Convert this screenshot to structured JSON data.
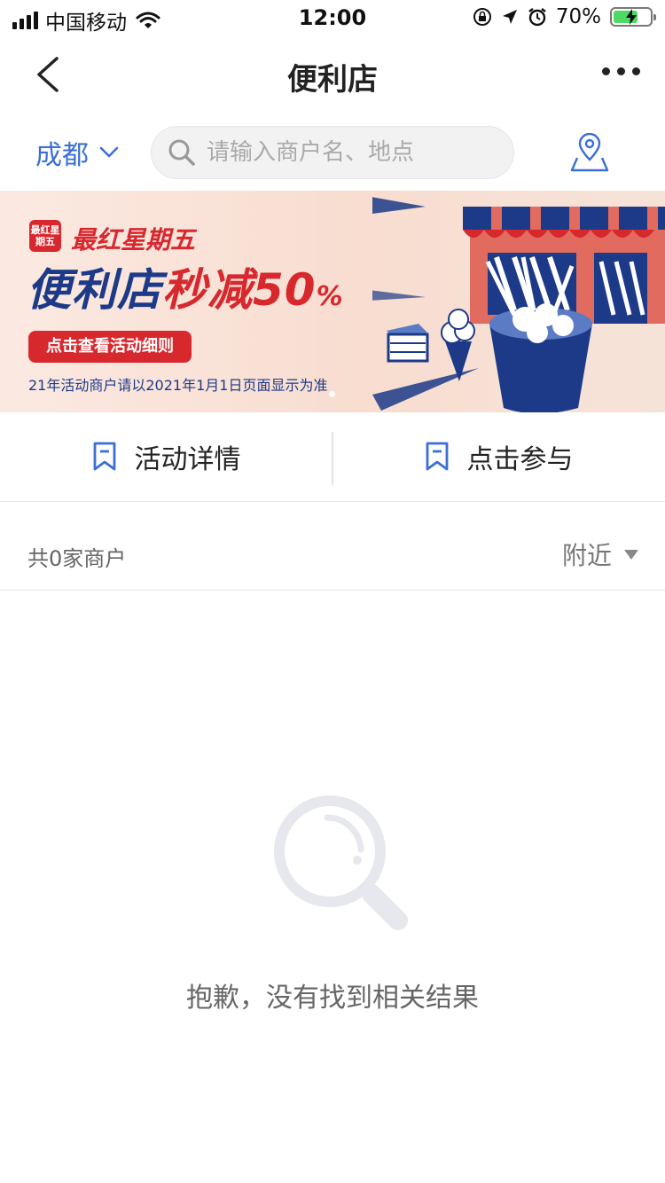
{
  "status_bar": {
    "carrier": "中国移动",
    "time": "12:00",
    "battery_percent": "70%",
    "icons": [
      "signal-icon",
      "wifi-icon",
      "rotation-lock-icon",
      "location-arrow-icon",
      "alarm-icon",
      "battery-charging-icon"
    ]
  },
  "nav": {
    "title": "便利店",
    "back_icon": "chevron-left-icon",
    "more_icon": "more-dots-icon"
  },
  "search_row": {
    "city": "成都",
    "search_placeholder": "请输入商户名、地点",
    "location_icon": "map-pin-icon"
  },
  "banner": {
    "logo_text": "最红星期五",
    "headline_small": "最红星期五",
    "headline_main_blue": "便利店",
    "headline_main_red": "秒减",
    "headline_number": "50",
    "headline_percent": "%",
    "rules_button": "点击查看活动细则",
    "note": "21年活动商户请以2021年1月1日页面显示为准",
    "colors": {
      "red": "#d7282e",
      "navy": "#1c3a88"
    }
  },
  "actions": [
    {
      "label": "活动详情",
      "icon": "bookmark-icon"
    },
    {
      "label": "点击参与",
      "icon": "bookmark-icon"
    }
  ],
  "list": {
    "count_text": "共0家商户",
    "sort_label": "附近"
  },
  "empty": {
    "message": "抱歉，没有找到相关结果",
    "icon": "magnifier-icon"
  },
  "colors": {
    "accent": "#3b6fd6",
    "text": "#222222",
    "muted": "#666666"
  }
}
